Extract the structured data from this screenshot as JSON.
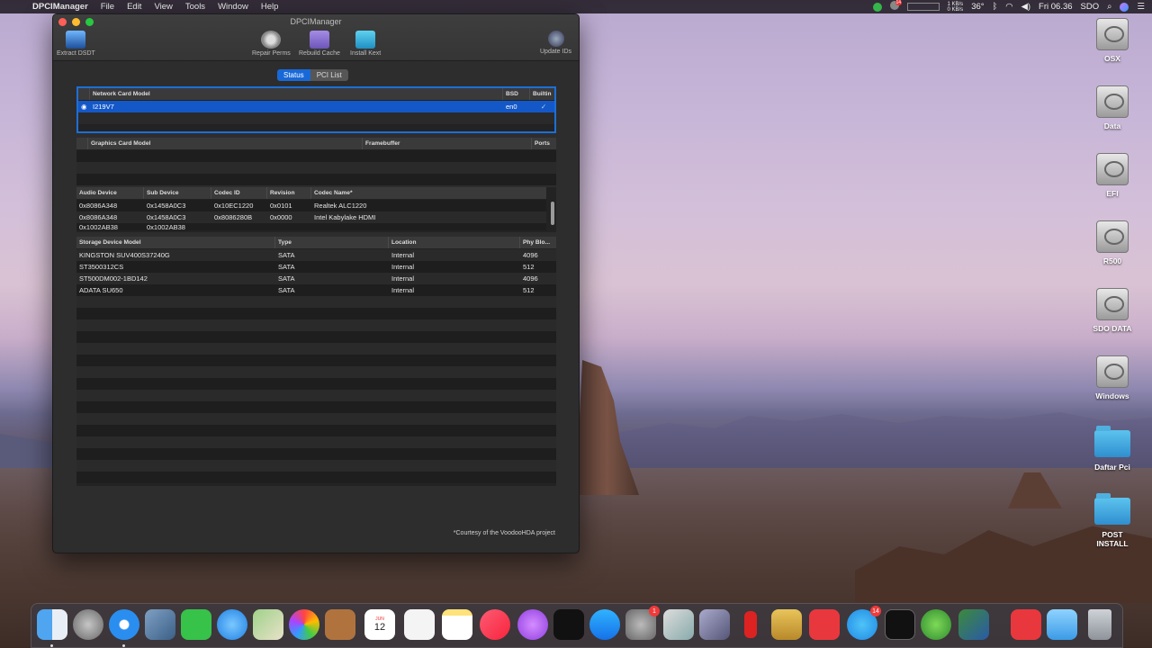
{
  "menubar": {
    "app_name": "DPCIManager",
    "items": [
      "File",
      "Edit",
      "View",
      "Tools",
      "Window",
      "Help"
    ],
    "net_up": "1 KB/s",
    "net_down": "0 KB/s",
    "temperature": "36°",
    "clock": "Fri 06.36",
    "user": "SDO",
    "notification_badge": "14"
  },
  "window": {
    "title": "DPCIManager",
    "toolbar": {
      "extract": "Extract DSDT",
      "repair": "Repair Perms",
      "rebuild": "Rebuild Cache",
      "install": "Install Kext",
      "update": "Update IDs"
    },
    "tabs": {
      "status": "Status",
      "pci": "PCI List"
    },
    "network": {
      "headers": [
        "Network Card Model",
        "BSD",
        "Builtin"
      ],
      "rows": [
        {
          "model": "I219V7",
          "bsd": "en0",
          "builtin": "✓"
        }
      ]
    },
    "graphics": {
      "headers": [
        "Graphics Card Model",
        "Framebuffer",
        "Ports"
      ]
    },
    "audio": {
      "headers": [
        "Audio Device",
        "Sub Device",
        "Codec ID",
        "Revision",
        "Codec Name*"
      ],
      "rows": [
        [
          "0x8086A348",
          "0x1458A0C3",
          "0x10EC1220",
          "0x0101",
          "Realtek ALC1220"
        ],
        [
          "0x8086A348",
          "0x1458A0C3",
          "0x8086280B",
          "0x0000",
          "Intel Kabylake HDMI"
        ],
        [
          "0x1002AB38",
          "0x1002AB38",
          "",
          "",
          ""
        ]
      ]
    },
    "storage": {
      "headers": [
        "Storage Device Model",
        "Type",
        "Location",
        "Phy Blo..."
      ],
      "rows": [
        [
          "KINGSTON SUV400S37240G",
          "SATA",
          "Internal",
          "4096"
        ],
        [
          "ST3500312CS",
          "SATA",
          "Internal",
          "512"
        ],
        [
          "ST500DM002-1BD142",
          "SATA",
          "Internal",
          "4096"
        ],
        [
          "ADATA SU650",
          "SATA",
          "Internal",
          "512"
        ]
      ]
    },
    "courtesy": "*Courtesy of the VoodooHDA project"
  },
  "desktop": {
    "disks": [
      "OSX",
      "Data",
      "EFI",
      "R500",
      "SDO DATA",
      "Windows"
    ],
    "folders": [
      "Daftar Pci",
      "POST INSTALL"
    ]
  },
  "dock": {
    "calendar_month": "JUN",
    "calendar_day": "12",
    "prefs_badge": "1",
    "telegram_badge": "14"
  }
}
